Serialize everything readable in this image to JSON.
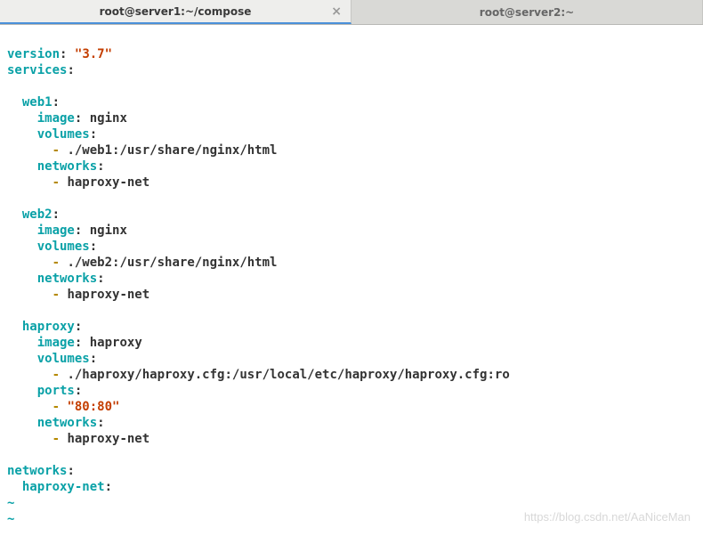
{
  "tabs": [
    {
      "title": "root@server1:~/compose",
      "active": true,
      "closable": true,
      "close_glyph": "×"
    },
    {
      "title": "root@server2:~",
      "active": false,
      "closable": false
    }
  ],
  "yaml": {
    "version_key": "version",
    "version_val": "\"3.7\"",
    "services_key": "services",
    "web1": {
      "name": "web1",
      "image_key": "image",
      "image_val": "nginx",
      "volumes_key": "volumes",
      "volume_item": "./web1:/usr/share/nginx/html",
      "networks_key": "networks",
      "network_item": "haproxy-net"
    },
    "web2": {
      "name": "web2",
      "image_key": "image",
      "image_val": "nginx",
      "volumes_key": "volumes",
      "volume_item": "./web2:/usr/share/nginx/html",
      "networks_key": "networks",
      "network_item": "haproxy-net"
    },
    "haproxy": {
      "name": "haproxy",
      "image_key": "image",
      "image_val": "haproxy",
      "volumes_key": "volumes",
      "volume_item": "./haproxy/haproxy.cfg:/usr/local/etc/haproxy/haproxy.cfg:ro",
      "ports_key": "ports",
      "ports_item": "\"80:80\"",
      "networks_key": "networks",
      "network_item": "haproxy-net"
    },
    "networks_key": "networks",
    "haproxy_net_key": "haproxy-net",
    "tilde": "~"
  },
  "watermark": "https://blog.csdn.net/AaNiceMan"
}
